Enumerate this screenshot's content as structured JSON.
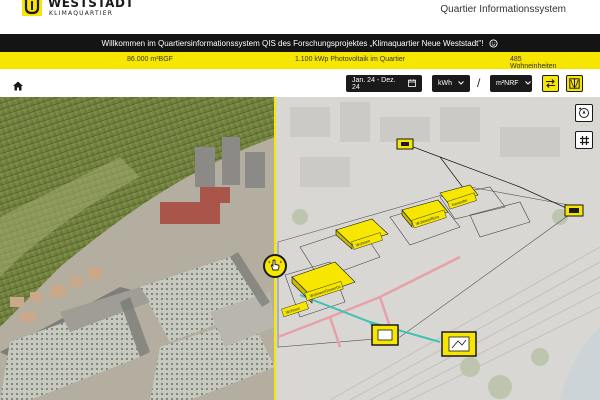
{
  "header": {
    "logo_line1": "WESTSTADT",
    "logo_line2": "KLIMAQUARTIER",
    "title": "Quartier Informationssystem"
  },
  "welcome": {
    "text": "Willkommen im Quartiersinformationssystem QIS des Forschungsprojektes „Klimaquartier Neue Weststadt\"!",
    "icon": "info-icon"
  },
  "stats": [
    {
      "label": "86.000 m²BGF"
    },
    {
      "label": "1.100 kWp Photovoltaik im Quartier"
    },
    {
      "label": "485 Wohneinheiten"
    }
  ],
  "toolbar": {
    "date_range": "Jan. 24 - Dez. 24",
    "unit": "kWh",
    "separator": "/",
    "area_unit": "m²NRF"
  },
  "map": {
    "building_labels": [
      "Wohnen/Gewerbe",
      "Wohnen",
      "Wohnen/Büro",
      "Gewerbe",
      "Wohnen"
    ]
  },
  "colors": {
    "accent": "#f6e600",
    "dark": "#141414",
    "pipe_red": "#e8a0a8",
    "pipe_teal": "#3fc1b5"
  }
}
